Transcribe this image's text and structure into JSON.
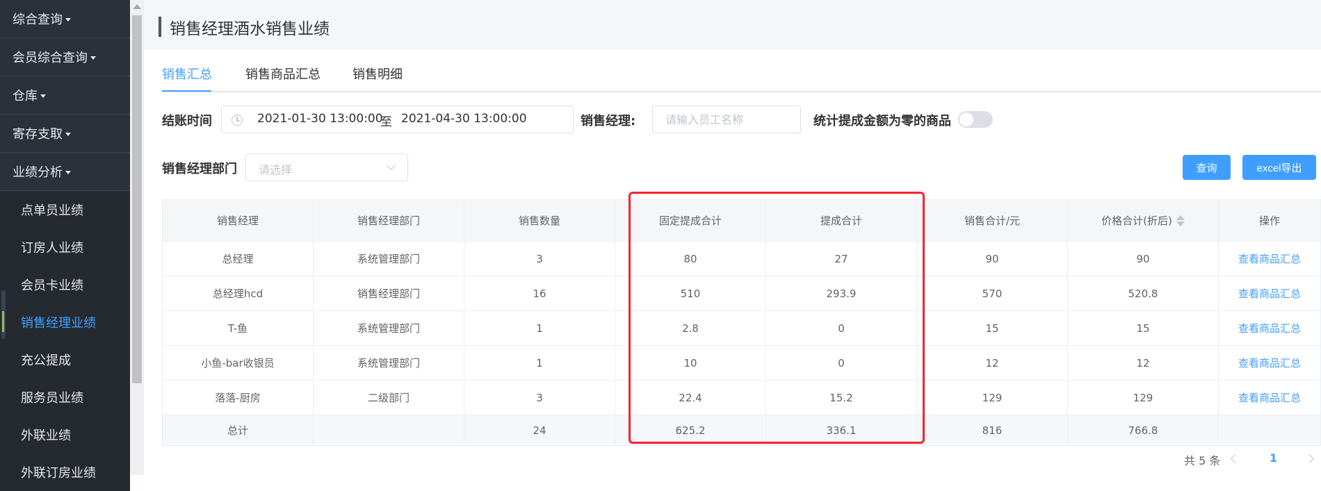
{
  "sidebar": {
    "groups": [
      {
        "label": "综合查询"
      },
      {
        "label": "会员综合查询"
      },
      {
        "label": "仓库"
      },
      {
        "label": "寄存支取"
      },
      {
        "label": "业绩分析"
      }
    ],
    "items": [
      {
        "label": "点单员业绩"
      },
      {
        "label": "订房人业绩"
      },
      {
        "label": "会员卡业绩"
      },
      {
        "label": "销售经理业绩"
      },
      {
        "label": "充公提成"
      },
      {
        "label": "服务员业绩"
      },
      {
        "label": "外联业绩"
      },
      {
        "label": "外联订房业绩"
      }
    ]
  },
  "header": {
    "title": "销售经理酒水销售业绩"
  },
  "tabs": [
    {
      "label": "销售汇总"
    },
    {
      "label": "销售商品汇总"
    },
    {
      "label": "销售明细"
    }
  ],
  "filters": {
    "checkout_time_label": "结账时间",
    "date_start": "2021-01-30 13:00:00",
    "date_sep": "至",
    "date_end": "2021-04-30 13:00:00",
    "manager_label": "销售经理:",
    "manager_placeholder": "请输入员工名称",
    "zero_commission_label": "统计提成金额为零的商品",
    "dept_label": "销售经理部门",
    "dept_placeholder": "请选择"
  },
  "buttons": {
    "query": "查询",
    "export": "excel导出"
  },
  "table": {
    "headers": [
      "销售经理",
      "销售经理部门",
      "销售数量",
      "固定提成合计",
      "提成合计",
      "销售合计/元",
      "价格合计(折后)",
      "操作"
    ],
    "rows": [
      [
        "总经理",
        "系统管理部门",
        "3",
        "80",
        "27",
        "90",
        "90",
        "查看商品汇总"
      ],
      [
        "总经理hcd",
        "销售经理部门",
        "16",
        "510",
        "293.9",
        "570",
        "520.8",
        "查看商品汇总"
      ],
      [
        "T-鱼",
        "系统管理部门",
        "1",
        "2.8",
        "0",
        "15",
        "15",
        "查看商品汇总"
      ],
      [
        "小鱼-bar收银员",
        "系统管理部门",
        "1",
        "10",
        "0",
        "12",
        "12",
        "查看商品汇总"
      ],
      [
        "落落-厨房",
        "二级部门",
        "3",
        "22.4",
        "15.2",
        "129",
        "129",
        "查看商品汇总"
      ]
    ],
    "summary": [
      "总计",
      "",
      "24",
      "625.2",
      "336.1",
      "816",
      "766.8",
      ""
    ]
  },
  "pagination": {
    "total_text": "共 5 条",
    "current_page": "1"
  },
  "colors": {
    "accent": "#409eff",
    "sidebar_bg": "#2b313a",
    "highlight": "#f5222d"
  }
}
